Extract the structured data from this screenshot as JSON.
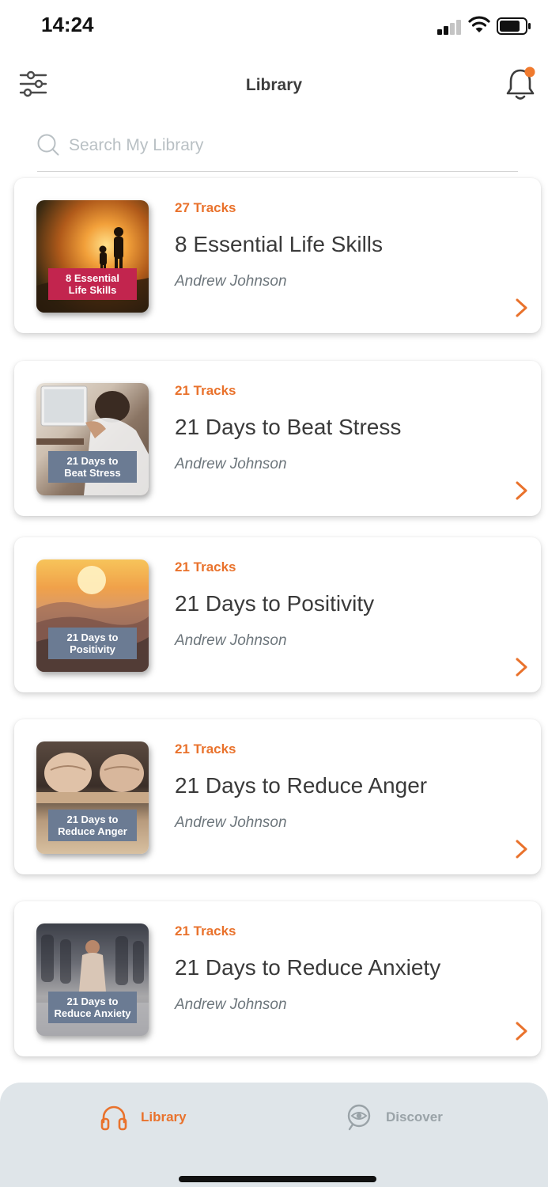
{
  "status_bar": {
    "time": "14:24"
  },
  "header": {
    "title": "Library",
    "filter_icon": "sliders-icon",
    "notification_icon": "bell-icon",
    "notification_badge_color": "#f07a2e"
  },
  "search": {
    "placeholder": "Search My Library",
    "value": "",
    "icon": "search-icon"
  },
  "colors": {
    "accent": "#e9722c",
    "title": "#3a3a3a",
    "author": "#6d767c",
    "tab_inactive": "#9aa3a8",
    "tab_bar_bg": "#dfe5e9"
  },
  "library": {
    "items": [
      {
        "tracks": "27 Tracks",
        "title": "8 Essential Life Skills",
        "author": "Andrew Johnson",
        "thumb_line1": "8 Essential",
        "thumb_line2": "Life Skills"
      },
      {
        "tracks": "21 Tracks",
        "title": "21 Days to Beat Stress",
        "author": "Andrew Johnson",
        "thumb_line1": "21 Days to",
        "thumb_line2": "Beat Stress"
      },
      {
        "tracks": "21 Tracks",
        "title": "21 Days to Positivity",
        "author": "Andrew Johnson",
        "thumb_line1": "21 Days to",
        "thumb_line2": "Positivity"
      },
      {
        "tracks": "21 Tracks",
        "title": "21 Days to Reduce Anger",
        "author": "Andrew Johnson",
        "thumb_line1": "21 Days to",
        "thumb_line2": "Reduce Anger"
      },
      {
        "tracks": "21 Tracks",
        "title": "21 Days to Reduce Anxiety",
        "author": "Andrew Johnson",
        "thumb_line1": "21 Days to",
        "thumb_line2": "Reduce Anxiety"
      }
    ]
  },
  "tab_bar": {
    "tabs": [
      {
        "label": "Library",
        "icon": "headphones-icon",
        "active": true
      },
      {
        "label": "Discover",
        "icon": "eye-icon",
        "active": false
      }
    ]
  }
}
